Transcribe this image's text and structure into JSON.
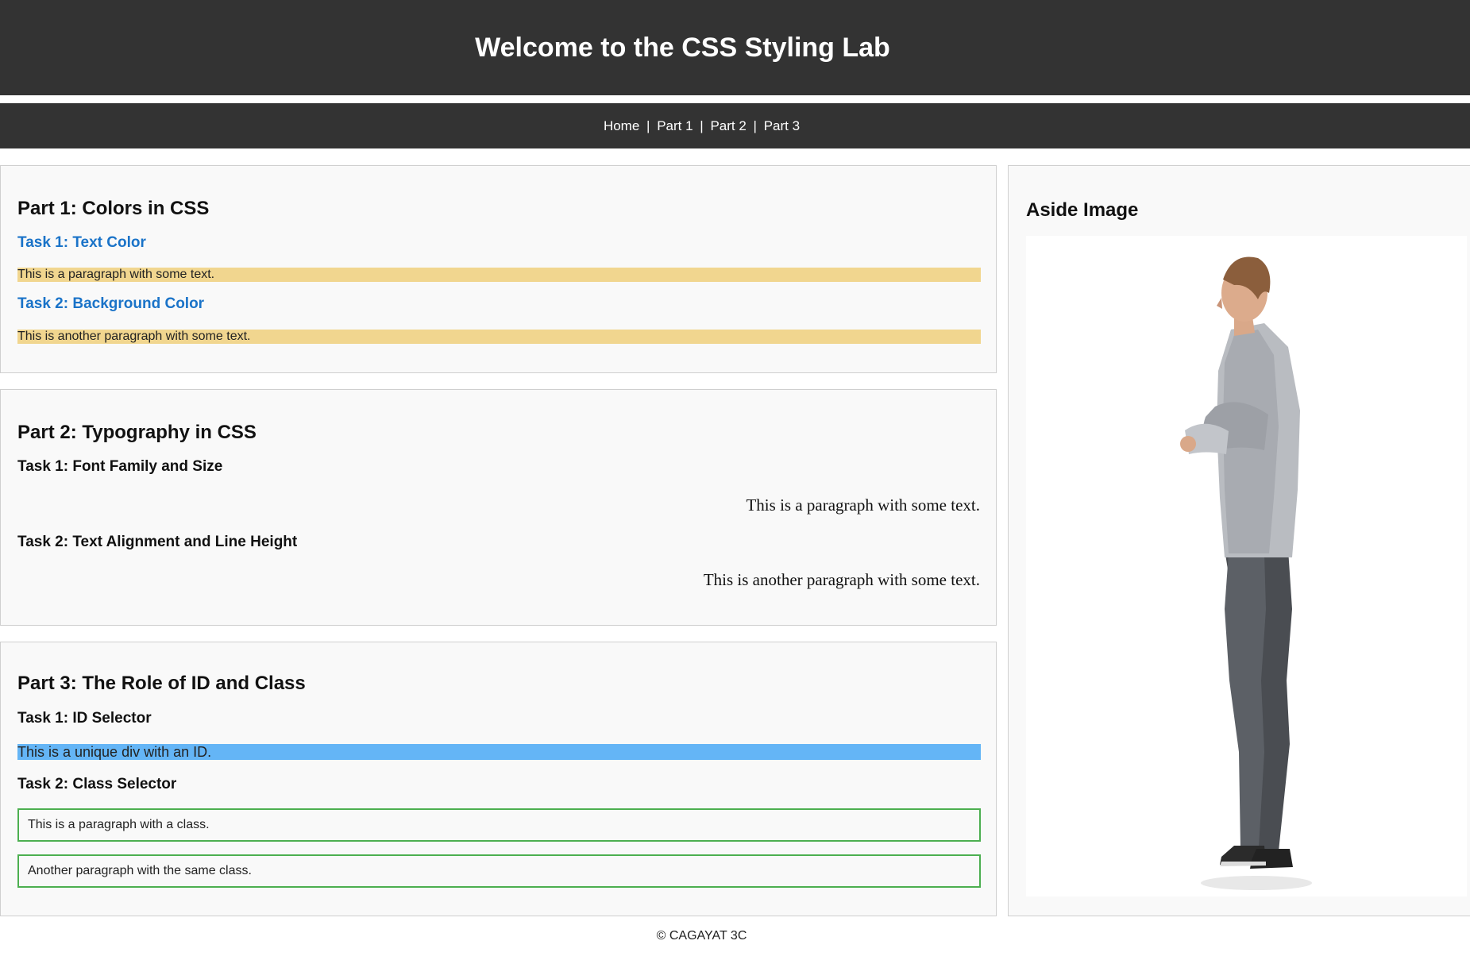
{
  "header": {
    "title": "Welcome to the CSS Styling Lab"
  },
  "nav": {
    "items": [
      "Home",
      "Part 1",
      "Part 2",
      "Part 3"
    ],
    "separator": "|"
  },
  "part1": {
    "title": "Part 1: Colors in CSS",
    "task1_title": "Task 1: Text Color",
    "task1_text": "This is a paragraph with some text.",
    "task2_title": "Task 2: Background Color",
    "task2_text": "This is another paragraph with some text."
  },
  "part2": {
    "title": "Part 2: Typography in CSS",
    "task1_title": "Task 1: Font Family and Size",
    "task1_text": "This is a paragraph with some text.",
    "task2_title": "Task 2: Text Alignment and Line Height",
    "task2_text": "This is another paragraph with some text."
  },
  "part3": {
    "title": "Part 3: The Role of ID and Class",
    "task1_title": "Task 1: ID Selector",
    "task1_text": "This is a unique div with an ID.",
    "task2_title": "Task 2: Class Selector",
    "class_p1": "This is a paragraph with a class.",
    "class_p2": "Another paragraph with the same class."
  },
  "aside": {
    "title": "Aside Image"
  },
  "footer": {
    "text": "© CAGAYAT 3C"
  },
  "colors": {
    "header_bg": "#333333",
    "task_heading_blue": "#1a73c8",
    "highlight_yellow": "#f1d68f",
    "id_blue": "#64b5f6",
    "class_border_green": "#4caf50"
  }
}
